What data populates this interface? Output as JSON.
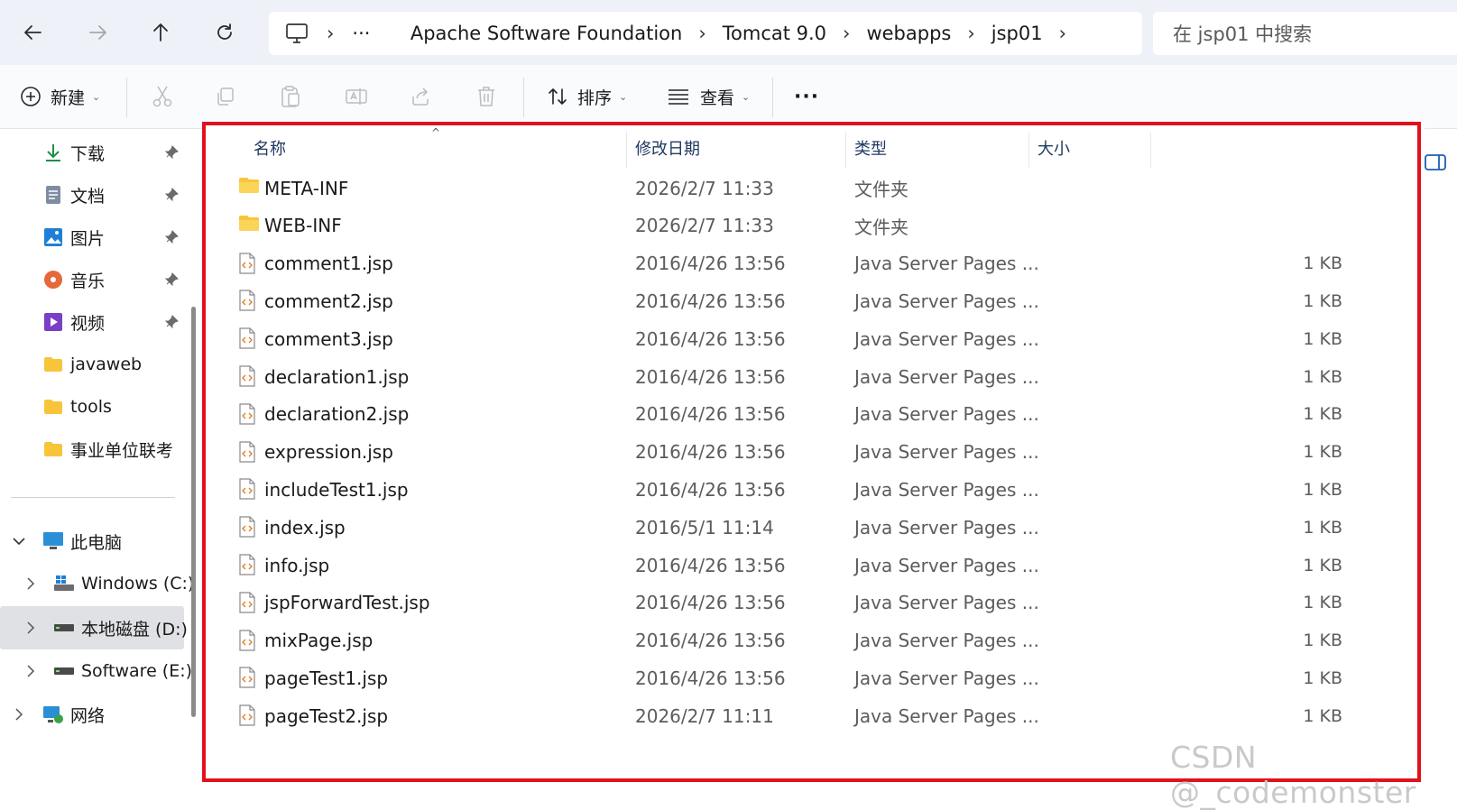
{
  "address": {
    "crumbs": [
      "Apache Software Foundation",
      "Tomcat 9.0",
      "webapps",
      "jsp01"
    ],
    "overflow": "···"
  },
  "search": {
    "placeholder": "在 jsp01 中搜索"
  },
  "toolbar": {
    "new_label": "新建",
    "sort_label": "排序",
    "view_label": "查看",
    "more_label": "···"
  },
  "sidebar": {
    "quick": [
      {
        "label": "下载",
        "icon": "download-icon"
      },
      {
        "label": "文档",
        "icon": "document-icon"
      },
      {
        "label": "图片",
        "icon": "pictures-icon"
      },
      {
        "label": "音乐",
        "icon": "music-icon"
      },
      {
        "label": "视频",
        "icon": "video-icon"
      },
      {
        "label": "javaweb",
        "icon": "folder-icon"
      },
      {
        "label": "tools",
        "icon": "folder-icon"
      },
      {
        "label": "事业单位联考",
        "icon": "folder-icon"
      }
    ],
    "this_pc": "此电脑",
    "drives": [
      {
        "label": "Windows (C:)",
        "icon": "windows-drive-icon"
      },
      {
        "label": "本地磁盘 (D:)",
        "icon": "drive-icon",
        "selected": true
      },
      {
        "label": "Software (E:)",
        "icon": "drive-icon"
      }
    ],
    "network": "网络"
  },
  "columns": {
    "name": "名称",
    "date": "修改日期",
    "type": "类型",
    "size": "大小"
  },
  "files": [
    {
      "name": "META-INF",
      "date": "2026/2/7 11:33",
      "type": "文件夹",
      "size": "",
      "kind": "folder"
    },
    {
      "name": "WEB-INF",
      "date": "2026/2/7 11:33",
      "type": "文件夹",
      "size": "",
      "kind": "folder"
    },
    {
      "name": "comment1.jsp",
      "date": "2016/4/26 13:56",
      "type": "Java Server Pages ...",
      "size": "1 KB",
      "kind": "jsp"
    },
    {
      "name": "comment2.jsp",
      "date": "2016/4/26 13:56",
      "type": "Java Server Pages ...",
      "size": "1 KB",
      "kind": "jsp"
    },
    {
      "name": "comment3.jsp",
      "date": "2016/4/26 13:56",
      "type": "Java Server Pages ...",
      "size": "1 KB",
      "kind": "jsp"
    },
    {
      "name": "declaration1.jsp",
      "date": "2016/4/26 13:56",
      "type": "Java Server Pages ...",
      "size": "1 KB",
      "kind": "jsp"
    },
    {
      "name": "declaration2.jsp",
      "date": "2016/4/26 13:56",
      "type": "Java Server Pages ...",
      "size": "1 KB",
      "kind": "jsp"
    },
    {
      "name": "expression.jsp",
      "date": "2016/4/26 13:56",
      "type": "Java Server Pages ...",
      "size": "1 KB",
      "kind": "jsp"
    },
    {
      "name": "includeTest1.jsp",
      "date": "2016/4/26 13:56",
      "type": "Java Server Pages ...",
      "size": "1 KB",
      "kind": "jsp"
    },
    {
      "name": "index.jsp",
      "date": "2016/5/1 11:14",
      "type": "Java Server Pages ...",
      "size": "1 KB",
      "kind": "jsp"
    },
    {
      "name": "info.jsp",
      "date": "2016/4/26 13:56",
      "type": "Java Server Pages ...",
      "size": "1 KB",
      "kind": "jsp"
    },
    {
      "name": "jspForwardTest.jsp",
      "date": "2016/4/26 13:56",
      "type": "Java Server Pages ...",
      "size": "1 KB",
      "kind": "jsp"
    },
    {
      "name": "mixPage.jsp",
      "date": "2016/4/26 13:56",
      "type": "Java Server Pages ...",
      "size": "1 KB",
      "kind": "jsp"
    },
    {
      "name": "pageTest1.jsp",
      "date": "2016/4/26 13:56",
      "type": "Java Server Pages ...",
      "size": "1 KB",
      "kind": "jsp"
    },
    {
      "name": "pageTest2.jsp",
      "date": "2026/2/7 11:11",
      "type": "Java Server Pages ...",
      "size": "1 KB",
      "kind": "jsp"
    }
  ],
  "watermark": "CSDN @_codemonster",
  "colors": {
    "highlight_frame": "#e0121c",
    "folder": "#f8c53a",
    "header_text": "#1f3a62"
  }
}
